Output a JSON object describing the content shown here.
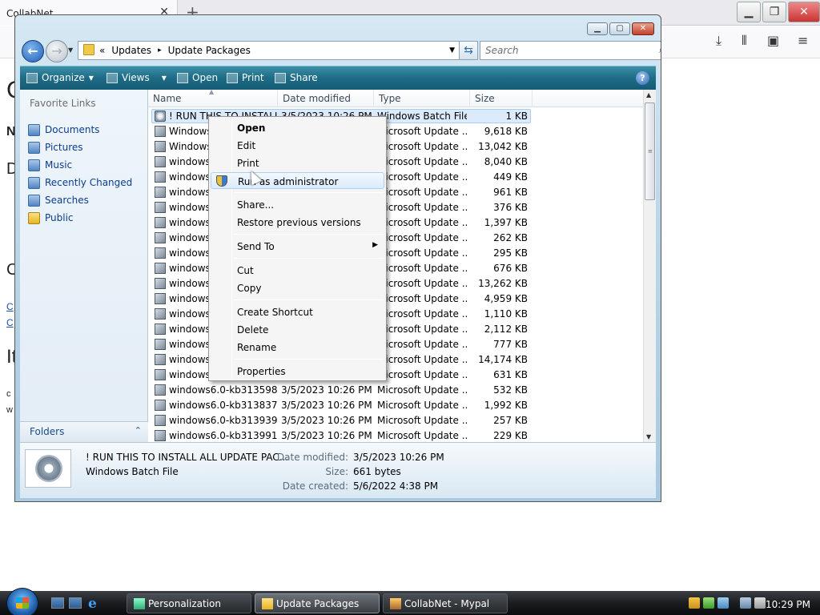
{
  "browser": {
    "tab_title": "CollabNet",
    "tab_close": "✕",
    "new_tab": "+",
    "page_fragments": [
      "C",
      "N",
      "D",
      "C",
      "C",
      "C",
      "It",
      "c",
      "w"
    ]
  },
  "explorer": {
    "breadcrumb": {
      "chevrons": "«",
      "items": [
        "Updates",
        "Update Packages"
      ],
      "separator": "▸"
    },
    "search_placeholder": "Search",
    "toolbar": {
      "organize": "Organize",
      "views": "Views",
      "open": "Open",
      "print": "Print",
      "share": "Share",
      "help": "?"
    },
    "left_pane": {
      "title": "Favorite Links",
      "items": [
        "Documents",
        "Pictures",
        "Music",
        "Recently Changed",
        "Searches",
        "Public"
      ],
      "folders_label": "Folders",
      "folders_chevron": "⌃"
    },
    "columns": [
      "Name",
      "Date modified",
      "Type",
      "Size"
    ],
    "rows": [
      {
        "name": "! RUN THIS TO INSTALL",
        "date": "3/5/2023 10:26 PM",
        "type": "Windows Batch File",
        "size": "1 KB"
      },
      {
        "name": "Windows",
        "date": "",
        "type": "Microsoft Update ...",
        "size": "9,618 KB"
      },
      {
        "name": "Windows",
        "date": "",
        "type": "Microsoft Update ...",
        "size": "13,042 KB"
      },
      {
        "name": "windows",
        "date": "",
        "type": "Microsoft Update ...",
        "size": "8,040 KB"
      },
      {
        "name": "windows",
        "date": "",
        "type": "Microsoft Update ...",
        "size": "449 KB"
      },
      {
        "name": "windows",
        "date": "",
        "type": "Microsoft Update ...",
        "size": "961 KB"
      },
      {
        "name": "windows",
        "date": "",
        "type": "Microsoft Update ...",
        "size": "376 KB"
      },
      {
        "name": "windows",
        "date": "",
        "type": "Microsoft Update ...",
        "size": "1,397 KB"
      },
      {
        "name": "windows",
        "date": "",
        "type": "Microsoft Update ...",
        "size": "262 KB"
      },
      {
        "name": "windows",
        "date": "",
        "type": "Microsoft Update ...",
        "size": "295 KB"
      },
      {
        "name": "windows",
        "date": "",
        "type": "Microsoft Update ...",
        "size": "676 KB"
      },
      {
        "name": "windows",
        "date": "",
        "type": "Microsoft Update ...",
        "size": "13,262 KB"
      },
      {
        "name": "windows",
        "date": "",
        "type": "Microsoft Update ...",
        "size": "4,959 KB"
      },
      {
        "name": "windows",
        "date": "",
        "type": "Microsoft Update ...",
        "size": "1,110 KB"
      },
      {
        "name": "windows",
        "date": "",
        "type": "Microsoft Update ...",
        "size": "2,112 KB"
      },
      {
        "name": "windows",
        "date": "",
        "type": "Microsoft Update ...",
        "size": "777 KB"
      },
      {
        "name": "windows",
        "date": "",
        "type": "Microsoft Update ...",
        "size": "14,174 KB"
      },
      {
        "name": "windows",
        "date": "",
        "type": "Microsoft Update ...",
        "size": "631 KB"
      },
      {
        "name": "windows6.0-kb313598...",
        "date": "3/5/2023 10:26 PM",
        "type": "Microsoft Update ...",
        "size": "532 KB"
      },
      {
        "name": "windows6.0-kb313837...",
        "date": "3/5/2023 10:26 PM",
        "type": "Microsoft Update ...",
        "size": "1,992 KB"
      },
      {
        "name": "windows6.0-kb313939...",
        "date": "3/5/2023 10:26 PM",
        "type": "Microsoft Update ...",
        "size": "257 KB"
      },
      {
        "name": "windows6.0-kb313991...",
        "date": "3/5/2023 10:26 PM",
        "type": "Microsoft Update ...",
        "size": "229 KB"
      }
    ],
    "details": {
      "name": "! RUN THIS TO INSTALL ALL UPDATE PAC...",
      "type": "Windows Batch File",
      "modified_label": "Date modified:",
      "modified_value": "3/5/2023 10:26 PM",
      "size_label": "Size:",
      "size_value": "661 bytes",
      "created_label": "Date created:",
      "created_value": "5/6/2022 4:38 PM"
    }
  },
  "context_menu": {
    "items": [
      {
        "label": "Open",
        "bold": true
      },
      {
        "label": "Edit"
      },
      {
        "label": "Print"
      },
      {
        "label": "Run as administrator",
        "highlighted": true,
        "icon": "shield-icon"
      },
      {
        "label": "Share..."
      },
      {
        "label": "Restore previous versions"
      },
      {
        "label": "Send To",
        "submenu_arrow": "▶"
      },
      {
        "label": "Cut"
      },
      {
        "label": "Copy"
      },
      {
        "label": "Create Shortcut"
      },
      {
        "label": "Delete"
      },
      {
        "label": "Rename"
      },
      {
        "label": "Properties"
      }
    ]
  },
  "taskbar": {
    "buttons": [
      {
        "label": "Personalization"
      },
      {
        "label": "Update Packages",
        "active": true
      },
      {
        "label": "CollabNet - Mypal"
      }
    ],
    "clock": "10:29 PM"
  },
  "colors": {
    "cmdbar": "#1d6b86",
    "link": "#0b3c8c",
    "selection": "#dcebfb"
  }
}
